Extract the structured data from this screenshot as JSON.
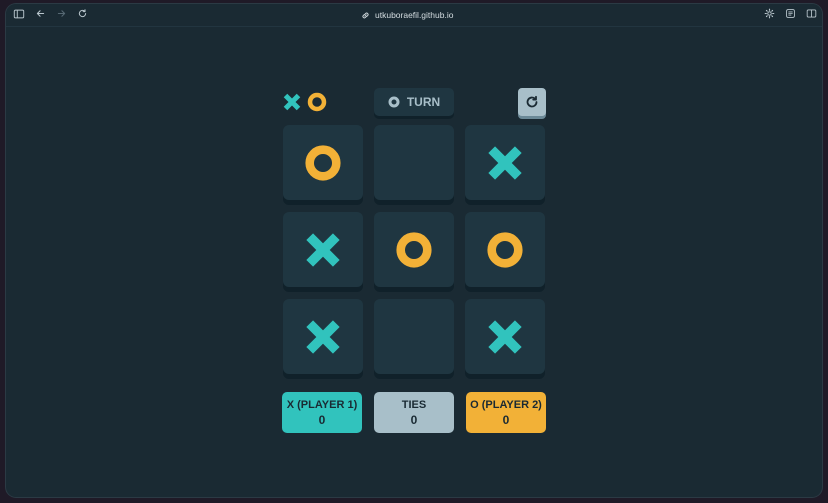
{
  "browser": {
    "url": "utkuboraefil.github.io"
  },
  "colors": {
    "x": "#31c3bd",
    "o": "#f2b137",
    "silver": "#a8bfc9",
    "cell": "#1f3641",
    "background": "#1a2a33"
  },
  "game": {
    "turn_label": "TURN",
    "turn_player": "o",
    "board": [
      "o",
      "",
      "x",
      "x",
      "o",
      "o",
      "x",
      "",
      "x"
    ]
  },
  "scores": {
    "x_label": "X (PLAYER 1)",
    "x_value": "0",
    "ties_label": "TIES",
    "ties_value": "0",
    "o_label": "O (PLAYER 2)",
    "o_value": "0"
  }
}
